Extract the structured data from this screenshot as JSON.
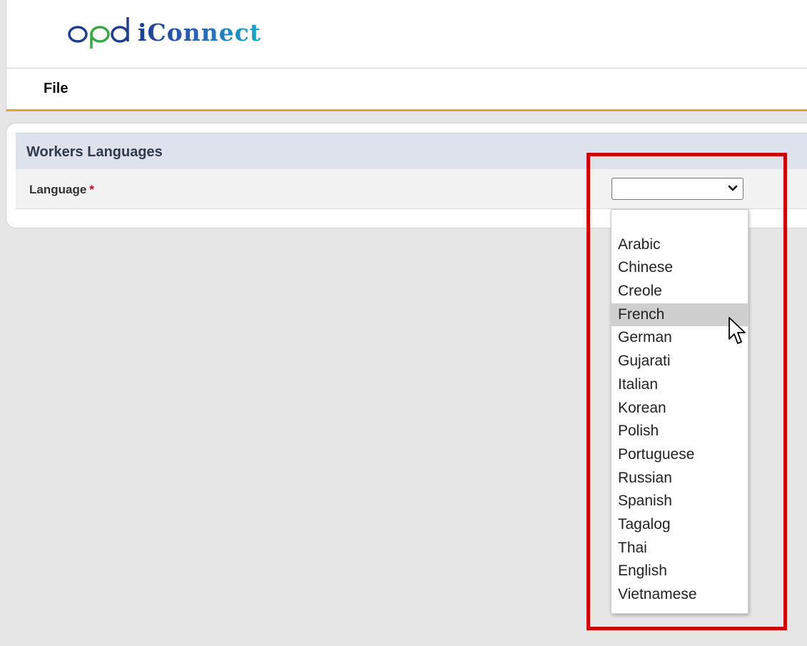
{
  "header": {
    "logo_text": "iConnect"
  },
  "menubar": {
    "file_label": "File"
  },
  "section": {
    "title": "Workers Languages"
  },
  "form": {
    "language_label": "Language",
    "required_marker": "*",
    "language_value": ""
  },
  "dropdown": {
    "options": [
      "",
      "Arabic",
      "Chinese",
      "Creole",
      "French",
      "German",
      "Gujarati",
      "Italian",
      "Korean",
      "Polish",
      "Portuguese",
      "Russian",
      "Spanish",
      "Tagalog",
      "Thai",
      "English",
      "Vietnamese"
    ],
    "hovered_option": "French"
  },
  "colors": {
    "accent_underline": "#e3a52b",
    "section_header_bg": "#dde2ec",
    "annotation_red": "#cc0000",
    "logo_green": "#35a843",
    "logo_blue": "#1d3f8f"
  },
  "icons": {
    "chevron": "chevron-down-icon",
    "cursor": "mouse-pointer-icon"
  }
}
